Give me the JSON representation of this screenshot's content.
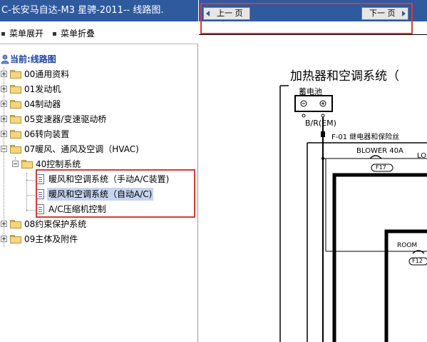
{
  "window": {
    "title": "C-长安马自达-M3 星骋-2011-- 线路图."
  },
  "menu": {
    "expand_label": "菜单展开",
    "collapse_label": "菜单折叠"
  },
  "tree": {
    "current_label": "当前:线路图",
    "items": [
      "00通用资料",
      "01发动机",
      "04制动器",
      "05变速器/变速驱动桥",
      "06转向装置",
      "07暖风、通风及空调（HVAC)",
      "40控制系统",
      "暖风和空调系统（手动A/C装置)",
      "暖风和空调系统（自动A/C)",
      "A/C压缩机控制",
      "08约束保护系统",
      "09主体及附件"
    ]
  },
  "nav": {
    "prev_label": "上一 页",
    "next_label": "下一 页"
  },
  "diagram": {
    "title": "加热器和空调系统（",
    "battery": "蓄电池",
    "wire": "B/R(EM)",
    "connector": "F-01  继电器和保险丝",
    "fuse_blower": "BLOWER 40A",
    "fuse_blower_code": "F17",
    "lo_label": "LO",
    "room": "ROOM",
    "room_code": "F12"
  },
  "colors": {
    "titlebar": "#2f5a9e",
    "highlight": "#d83a3a",
    "selection": "#c6d5ee"
  }
}
